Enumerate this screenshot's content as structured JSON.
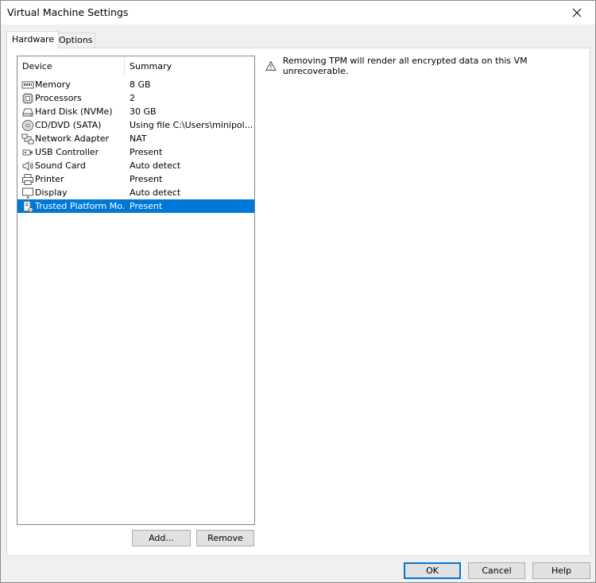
{
  "window": {
    "title": "Virtual Machine Settings"
  },
  "tabs": [
    {
      "label": "Hardware"
    },
    {
      "label": "Options"
    }
  ],
  "device_list": {
    "headers": {
      "device": "Device",
      "summary": "Summary"
    },
    "rows": [
      {
        "device": "Memory",
        "summary": "8 GB",
        "icon": "memory-icon"
      },
      {
        "device": "Processors",
        "summary": "2",
        "icon": "processor-icon"
      },
      {
        "device": "Hard Disk (NVMe)",
        "summary": "30 GB",
        "icon": "hard-disk-icon"
      },
      {
        "device": "CD/DVD (SATA)",
        "summary": "Using file C:\\Users\\minipol...",
        "icon": "cd-dvd-icon"
      },
      {
        "device": "Network Adapter",
        "summary": "NAT",
        "icon": "network-adapter-icon"
      },
      {
        "device": "USB Controller",
        "summary": "Present",
        "icon": "usb-icon"
      },
      {
        "device": "Sound Card",
        "summary": "Auto detect",
        "icon": "speaker-icon"
      },
      {
        "device": "Printer",
        "summary": "Present",
        "icon": "printer-icon"
      },
      {
        "device": "Display",
        "summary": "Auto detect",
        "icon": "display-icon"
      },
      {
        "device": "Trusted Platform Mo...",
        "summary": "Present",
        "icon": "tpm-icon",
        "selected": true
      }
    ]
  },
  "warning": {
    "text": "Removing TPM will render all encrypted data on this VM unrecoverable.",
    "icon": "warning-icon"
  },
  "list_buttons": {
    "add": "Add...",
    "remove": "Remove"
  },
  "dialog_buttons": {
    "ok": "OK",
    "cancel": "Cancel",
    "help": "Help"
  },
  "colors": {
    "selection": "#0078d7",
    "default_button_border": "#0078d7"
  }
}
